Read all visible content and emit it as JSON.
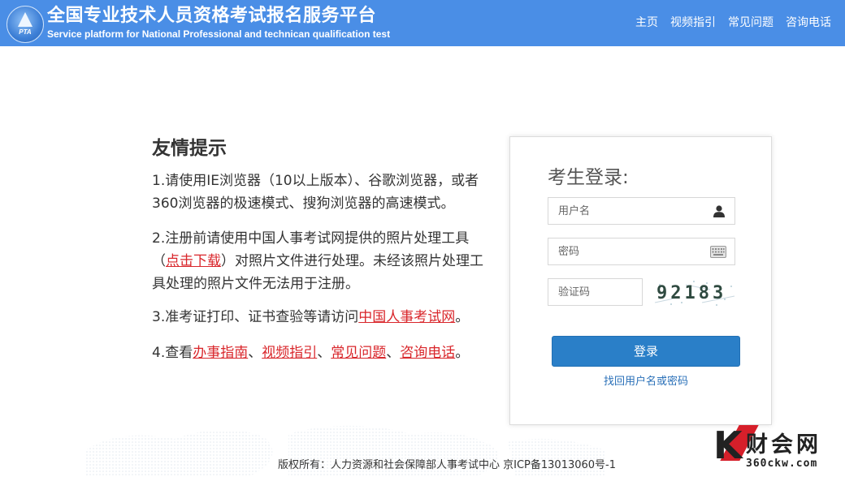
{
  "header": {
    "logo_text": "PTA",
    "title": "全国专业技术人员资格考试报名服务平台",
    "subtitle": "Service platform for National Professional and technican qualification test",
    "nav": [
      "主页",
      "视频指引",
      "常见问题",
      "咨询电话"
    ]
  },
  "notice": {
    "title": "友情提示",
    "item1": "1.请使用IE浏览器（10以上版本）、谷歌浏览器，或者360浏览器的极速模式、搜狗浏览器的高速模式。",
    "item2_pre": "2.注册前请使用中国人事考试网提供的照片处理工具（",
    "item2_link": "点击下载",
    "item2_post": "）对照片文件进行处理。未经该照片处理工具处理的照片文件无法用于注册。",
    "item3_pre": "3.准考证打印、证书查验等请访问",
    "item3_link": "中国人事考试网",
    "item3_post": "。",
    "item4_pre": "4.查看",
    "item4_links": [
      "办事指南",
      "视频指引",
      "常见问题",
      "咨询电话"
    ],
    "item4_sep": "、",
    "item4_post": "。"
  },
  "login": {
    "title": "考生登录:",
    "username_placeholder": "用户名",
    "password_placeholder": "密码",
    "captcha_placeholder": "验证码",
    "captcha_text": "92183",
    "submit_label": "登录",
    "forgot_label": "找回用户名或密码"
  },
  "footer": {
    "copyright": "版权所有：人力资源和社会保障部人事考试中心 京ICP备13013060号-1"
  },
  "watermark": {
    "letter": "K",
    "cn": "财会网",
    "en": "360ckw.com"
  },
  "colors": {
    "header_bg": "#4a8ee6",
    "link_red": "#d9262b",
    "button_blue": "#2a7fc8"
  },
  "icons": {
    "username": "user-icon",
    "password": "keyboard-icon"
  }
}
